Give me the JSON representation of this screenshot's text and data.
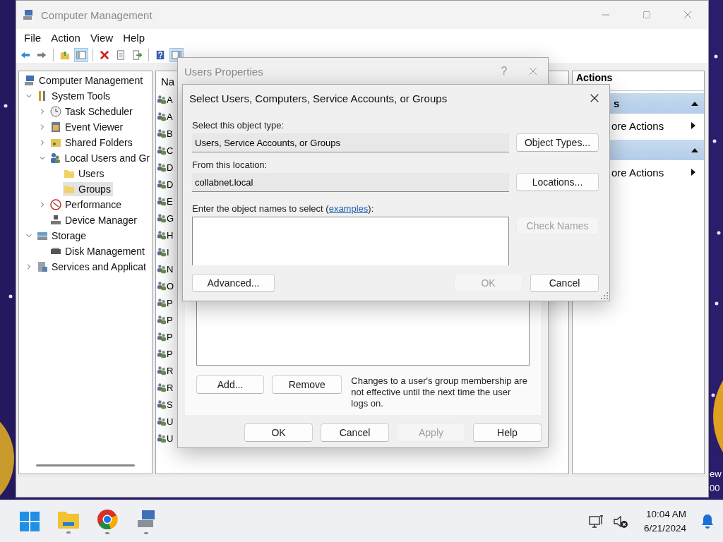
{
  "main_window": {
    "title": "Computer Management",
    "menu": [
      "File",
      "Action",
      "View",
      "Help"
    ],
    "tree": [
      {
        "label": "Computer Management",
        "kind": "computer",
        "selected": false,
        "children": [
          {
            "label": "System Tools",
            "kind": "tools",
            "expanded": true,
            "selected": false,
            "children": [
              {
                "label": "Task Scheduler",
                "kind": "clock",
                "expanded": false,
                "selected": false
              },
              {
                "label": "Event Viewer",
                "kind": "log",
                "expanded": false,
                "selected": false
              },
              {
                "label": "Shared Folders",
                "kind": "share",
                "expanded": false,
                "selected": false
              },
              {
                "label": "Local Users and Gr",
                "kind": "users",
                "expanded": true,
                "selected": false,
                "children": [
                  {
                    "label": "Users",
                    "kind": "folder",
                    "selected": false
                  },
                  {
                    "label": "Groups",
                    "kind": "folder",
                    "selected": true
                  }
                ]
              },
              {
                "label": "Performance",
                "kind": "perf",
                "expanded": false,
                "selected": false
              },
              {
                "label": "Device Manager",
                "kind": "device",
                "selected": false
              }
            ]
          },
          {
            "label": "Storage",
            "kind": "storage",
            "expanded": true,
            "selected": false,
            "children": [
              {
                "label": "Disk Management",
                "kind": "disk",
                "selected": false
              }
            ]
          },
          {
            "label": "Services and Applicat",
            "kind": "services",
            "expanded": false,
            "selected": false
          }
        ]
      }
    ],
    "list": {
      "column_header": "Na",
      "rows": [
        "A",
        "A",
        "B",
        "C",
        "D",
        "D",
        "E",
        "G",
        "H",
        "I",
        "N",
        "O",
        "P",
        "P",
        "P",
        "P",
        "R",
        "R",
        "S",
        "U",
        "U"
      ]
    },
    "actions": {
      "title": "Actions",
      "sections": [
        {
          "header": "s",
          "items": [
            "ore Actions"
          ]
        },
        {
          "items": [
            "ore Actions"
          ]
        }
      ]
    }
  },
  "properties_dialog": {
    "title": "Users Properties",
    "help": "?",
    "member_buttons": [
      "Add...",
      "Remove"
    ],
    "note": "Changes to a user's group membership are not effective until the next time the user logs on.",
    "buttons": [
      {
        "label": "OK",
        "disabled": false
      },
      {
        "label": "Cancel",
        "disabled": false
      },
      {
        "label": "Apply",
        "disabled": true
      },
      {
        "label": "Help",
        "disabled": false
      }
    ]
  },
  "select_dialog": {
    "title": "Select Users, Computers, Service Accounts, or Groups",
    "fields": [
      {
        "label": "Select this object type:",
        "value": "Users, Service Accounts, or Groups",
        "button": "Object Types..."
      },
      {
        "label": "From this location:",
        "value": "collabnet.local",
        "button": "Locations..."
      }
    ],
    "names": {
      "label_before": "Enter the object names to select (",
      "link": "examples",
      "label_after": "):"
    },
    "check_names": {
      "label": "Check Names",
      "disabled": true
    },
    "advanced": "Advanced...",
    "buttons": [
      {
        "label": "OK",
        "disabled": true
      },
      {
        "label": "Cancel",
        "disabled": false
      }
    ]
  },
  "desktop_labels": [
    "ew",
    "00"
  ],
  "taskbar": {
    "time": "10:04 AM",
    "date": "6/21/2024"
  }
}
